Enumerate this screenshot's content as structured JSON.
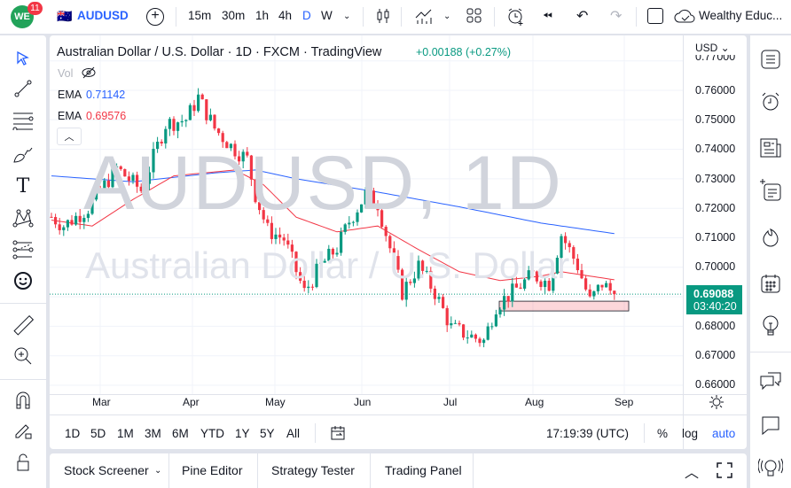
{
  "topbar": {
    "notification_count": "11",
    "symbol": "AUDUSD",
    "intervals": [
      "15m",
      "30m",
      "1h",
      "4h",
      "D",
      "W"
    ],
    "active_interval": "D",
    "account": "Wealthy Educ..."
  },
  "legend": {
    "title": "Australian Dollar / U.S. Dollar · 1D · FXCM · TradingView",
    "change": "+0.00188 (+0.27%)",
    "vol_label": "Vol",
    "ema1_label": "EMA",
    "ema1_value": "0.71142",
    "ema2_label": "EMA",
    "ema2_value": "0.69576"
  },
  "watermark": {
    "symbol": "AUDUSD, 1D",
    "name": "Australian Dollar / U.S. Dollar"
  },
  "price_axis": {
    "currency": "USD",
    "labels": [
      "0.77000",
      "0.76000",
      "0.75000",
      "0.74000",
      "0.73000",
      "0.72000",
      "0.71000",
      "0.70000",
      "0.68000",
      "0.67000",
      "0.66000"
    ],
    "current_price": "0.69088",
    "countdown": "03:40:20"
  },
  "time_axis": {
    "labels": [
      "Mar",
      "Apr",
      "May",
      "Jun",
      "Jul",
      "Aug",
      "Sep"
    ]
  },
  "range_bar": {
    "ranges": [
      "1D",
      "5D",
      "1M",
      "3M",
      "6M",
      "YTD",
      "1Y",
      "5Y",
      "All"
    ],
    "clock": "17:19:39 (UTC)",
    "percent": "%",
    "log": "log",
    "auto": "auto"
  },
  "bottom_tabs": [
    "Stock Screener",
    "Pine Editor",
    "Strategy Tester",
    "Trading Panel"
  ],
  "colors": {
    "up": "#089981",
    "down": "#f23645",
    "ema_long": "#2962ff",
    "ema_short": "#f23645",
    "accent": "#2962ff"
  },
  "chart_data": {
    "type": "candlestick",
    "price_path": [
      [
        0,
        0.7171
      ],
      [
        3,
        0.7141
      ],
      [
        9,
        0.72
      ],
      [
        16,
        0.7336
      ],
      [
        22,
        0.7261
      ],
      [
        28,
        0.7486
      ],
      [
        33,
        0.7501
      ],
      [
        36,
        0.7576
      ],
      [
        40,
        0.7471
      ],
      [
        44,
        0.7411
      ],
      [
        48,
        0.7366
      ],
      [
        50,
        0.7246
      ],
      [
        53,
        0.7126
      ],
      [
        57,
        0.7096
      ],
      [
        62,
        0.6915
      ],
      [
        66,
        0.7005
      ],
      [
        70,
        0.7065
      ],
      [
        73,
        0.7156
      ],
      [
        77,
        0.7246
      ],
      [
        80,
        0.7216
      ],
      [
        83,
        0.7065
      ],
      [
        86,
        0.6915
      ],
      [
        90,
        0.7005
      ],
      [
        94,
        0.6915
      ],
      [
        98,
        0.6795
      ],
      [
        103,
        0.6765
      ],
      [
        106,
        0.675
      ],
      [
        109,
        0.687
      ],
      [
        113,
        0.6915
      ],
      [
        118,
        0.6975
      ],
      [
        122,
        0.6945
      ],
      [
        125,
        0.7111
      ],
      [
        129,
        0.7005
      ],
      [
        132,
        0.6885
      ],
      [
        135,
        0.6945
      ],
      [
        138,
        0.69088
      ]
    ],
    "ema_long_path": [
      [
        0,
        0.731
      ],
      [
        20,
        0.729
      ],
      [
        40,
        0.732
      ],
      [
        50,
        0.733
      ],
      [
        60,
        0.73
      ],
      [
        80,
        0.7255
      ],
      [
        100,
        0.7205
      ],
      [
        120,
        0.715
      ],
      [
        138,
        0.71142
      ]
    ],
    "ema_short_path": [
      [
        0,
        0.716
      ],
      [
        10,
        0.714
      ],
      [
        20,
        0.723
      ],
      [
        30,
        0.731
      ],
      [
        45,
        0.733
      ],
      [
        52,
        0.728
      ],
      [
        60,
        0.717
      ],
      [
        70,
        0.712
      ],
      [
        80,
        0.714
      ],
      [
        90,
        0.706
      ],
      [
        100,
        0.6985
      ],
      [
        110,
        0.6955
      ],
      [
        120,
        0.697
      ],
      [
        125,
        0.6985
      ],
      [
        138,
        0.69576
      ]
    ],
    "support_zone": [
      0.6852,
      0.6885
    ],
    "ylim": [
      0.655,
      0.772
    ]
  }
}
